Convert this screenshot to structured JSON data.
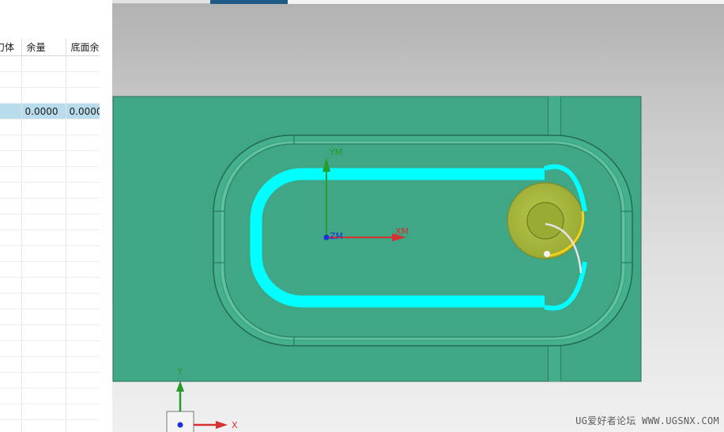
{
  "operation_navigator": {
    "columns": [
      "刀体",
      "余量",
      "底面余"
    ],
    "rows": [
      [
        "",
        "",
        ""
      ],
      [
        "",
        "",
        ""
      ],
      [
        "",
        "",
        ""
      ],
      [
        "",
        "0.0000",
        "0.0000"
      ],
      [
        "",
        "",
        ""
      ],
      [
        "",
        "",
        ""
      ],
      [
        "",
        "",
        ""
      ],
      [
        "",
        "",
        ""
      ],
      [
        "",
        "",
        ""
      ],
      [
        "",
        "",
        ""
      ],
      [
        "",
        "",
        ""
      ],
      [
        "",
        "",
        ""
      ],
      [
        "",
        "",
        ""
      ],
      [
        "",
        "",
        ""
      ],
      [
        "",
        "",
        ""
      ],
      [
        "",
        "",
        ""
      ],
      [
        "",
        "",
        ""
      ],
      [
        "",
        "",
        ""
      ],
      [
        "",
        "",
        ""
      ],
      [
        "",
        "",
        ""
      ],
      [
        "",
        "",
        ""
      ],
      [
        "",
        "",
        ""
      ],
      [
        "",
        "",
        ""
      ],
      [
        "",
        "",
        ""
      ],
      [
        "",
        "",
        ""
      ]
    ],
    "selected_row": 3
  },
  "graphics_window": {
    "wcs_labels": {
      "x": "XM",
      "y": "YM",
      "z": "ZM"
    },
    "absolute_triad_labels": {
      "x": "X",
      "y": "Y"
    },
    "colors": {
      "part_face": "#3fa686",
      "toolpath": "#00ffff",
      "tool_holder": "#a9b83c",
      "tool_arc": "#f4d21a",
      "x_axis": "#d63030",
      "y_axis": "#2a9a2a",
      "z_axis": "#2030d8"
    }
  },
  "watermark": "UG爱好者论坛 WWW.UGSNX.COM"
}
